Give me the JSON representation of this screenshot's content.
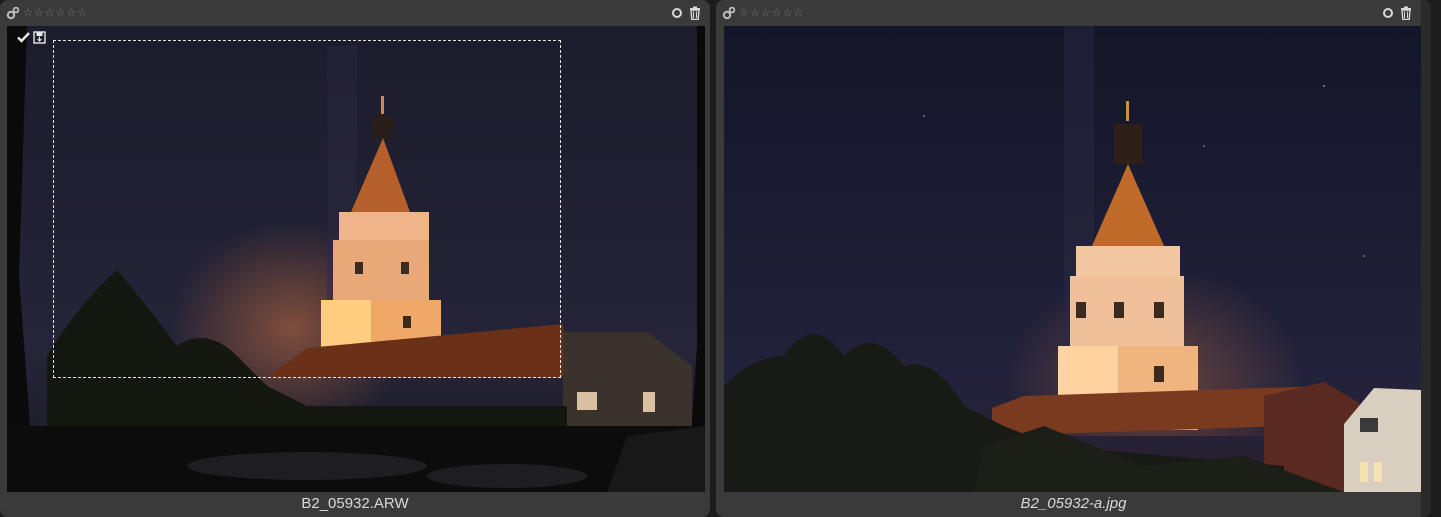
{
  "left_pane": {
    "filename": "B2_05932.ARW",
    "rating_stars": 6,
    "icons": {
      "group": "gears-icon",
      "reject": "circle-icon",
      "delete": "trash-icon",
      "selected": "checkmark-icon",
      "altered": "save-icon"
    }
  },
  "right_pane": {
    "filename": "B2_05932-a.jpg",
    "rating_stars": 6,
    "icons": {
      "group": "gears-icon",
      "reject": "circle-icon",
      "delete": "trash-icon"
    }
  },
  "colors": {
    "panel_bg": "#3a3a3a",
    "text": "#d9d9d9",
    "star": "#7a7a7a"
  }
}
